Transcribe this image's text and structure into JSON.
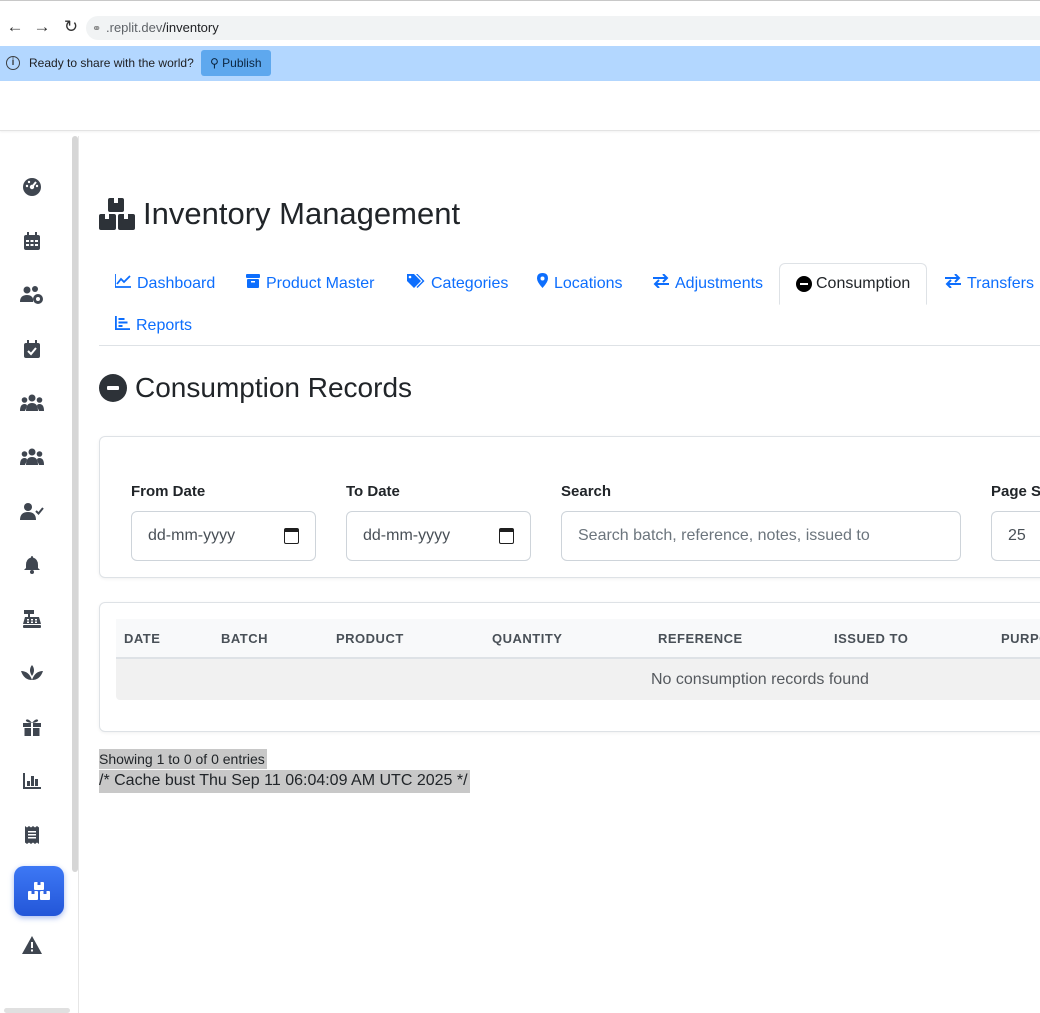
{
  "browser": {
    "url_prefix": ".replit.dev",
    "url_path": "/inventory"
  },
  "banner": {
    "text": "Ready to share with the world?",
    "publish_label": "Publish"
  },
  "sidebar": {
    "items": [
      {
        "icon": "gauge-icon"
      },
      {
        "icon": "calendar-icon"
      },
      {
        "icon": "users-gear-icon"
      },
      {
        "icon": "calendar-check-icon"
      },
      {
        "icon": "people-group-icon"
      },
      {
        "icon": "people-group-icon"
      },
      {
        "icon": "user-check-icon"
      },
      {
        "icon": "bell-icon"
      },
      {
        "icon": "cash-register-icon"
      },
      {
        "icon": "spa-icon"
      },
      {
        "icon": "gift-icon"
      },
      {
        "icon": "chart-bar-icon"
      },
      {
        "icon": "receipt-icon"
      },
      {
        "icon": "boxes-icon",
        "active": true
      },
      {
        "icon": "warning-icon"
      }
    ]
  },
  "page": {
    "title": "Inventory Management"
  },
  "tabs": [
    {
      "label": "Dashboard",
      "icon": "chart-line-icon"
    },
    {
      "label": "Product Master",
      "icon": "box-icon"
    },
    {
      "label": "Categories",
      "icon": "tags-icon"
    },
    {
      "label": "Locations",
      "icon": "map-marker-icon"
    },
    {
      "label": "Adjustments",
      "icon": "exchange-icon"
    },
    {
      "label": "Consumption",
      "icon": "minus-circle-icon",
      "active": true
    },
    {
      "label": "Transfers",
      "icon": "exchange-icon"
    },
    {
      "label": "Reports",
      "icon": "chart-bar-icon"
    }
  ],
  "section": {
    "title": "Consumption Records"
  },
  "filters": {
    "from_date_label": "From Date",
    "from_date_placeholder": "dd-mm-yyyy",
    "to_date_label": "To Date",
    "to_date_placeholder": "dd-mm-yyyy",
    "search_label": "Search",
    "search_placeholder": "Search batch, reference, notes, issued to",
    "page_size_label": "Page S",
    "page_size_value": "25"
  },
  "table": {
    "columns": [
      "DATE",
      "BATCH",
      "PRODUCT",
      "QUANTITY",
      "REFERENCE",
      "ISSUED TO",
      "PURPO"
    ],
    "empty_message": "No consumption records found"
  },
  "footer": {
    "info": "Showing 1 to 0 of 0 entries",
    "cache_note": "/* Cache bust Thu Sep 11 06:04:09 AM UTC 2025 */"
  }
}
